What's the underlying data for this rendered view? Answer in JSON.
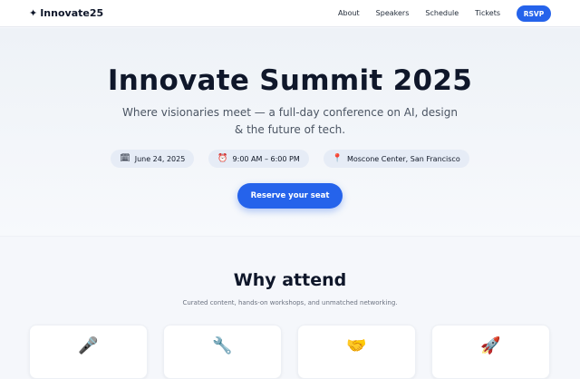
{
  "nav": {
    "brand": "Innovate25",
    "brand_icon": "sparkle-icon",
    "links": [
      "About",
      "Speakers",
      "Schedule",
      "Tickets"
    ],
    "rsvp": "RSVP"
  },
  "hero": {
    "title": "Innovate Summit 2025",
    "subtitle": "Where visionaries meet — a full-day conference on AI, design & the future of tech.",
    "chips": [
      {
        "icon": "calendar-icon",
        "glyph": "🗓",
        "text": "June 24, 2025"
      },
      {
        "icon": "alarm-clock-icon",
        "glyph": "⏰",
        "text": "9:00 AM – 6:00 PM"
      },
      {
        "icon": "map-pin-icon",
        "glyph": "📍",
        "text": "Moscone Center, San Francisco"
      }
    ],
    "cta": "Reserve your seat"
  },
  "why": {
    "title": "Why attend",
    "subtitle": "Curated content, hands-on workshops, and unmatched networking.",
    "cards": [
      {
        "icon": "microphone-icon",
        "glyph": "🎤"
      },
      {
        "icon": "wrench-icon",
        "glyph": "🔧"
      },
      {
        "icon": "handshake-icon",
        "glyph": "🤝"
      },
      {
        "icon": "rocket-icon",
        "glyph": "🚀"
      }
    ]
  },
  "colors": {
    "accent": "#2563eb",
    "title": "#0f172a",
    "chip_bg": "#e6ecf6"
  }
}
